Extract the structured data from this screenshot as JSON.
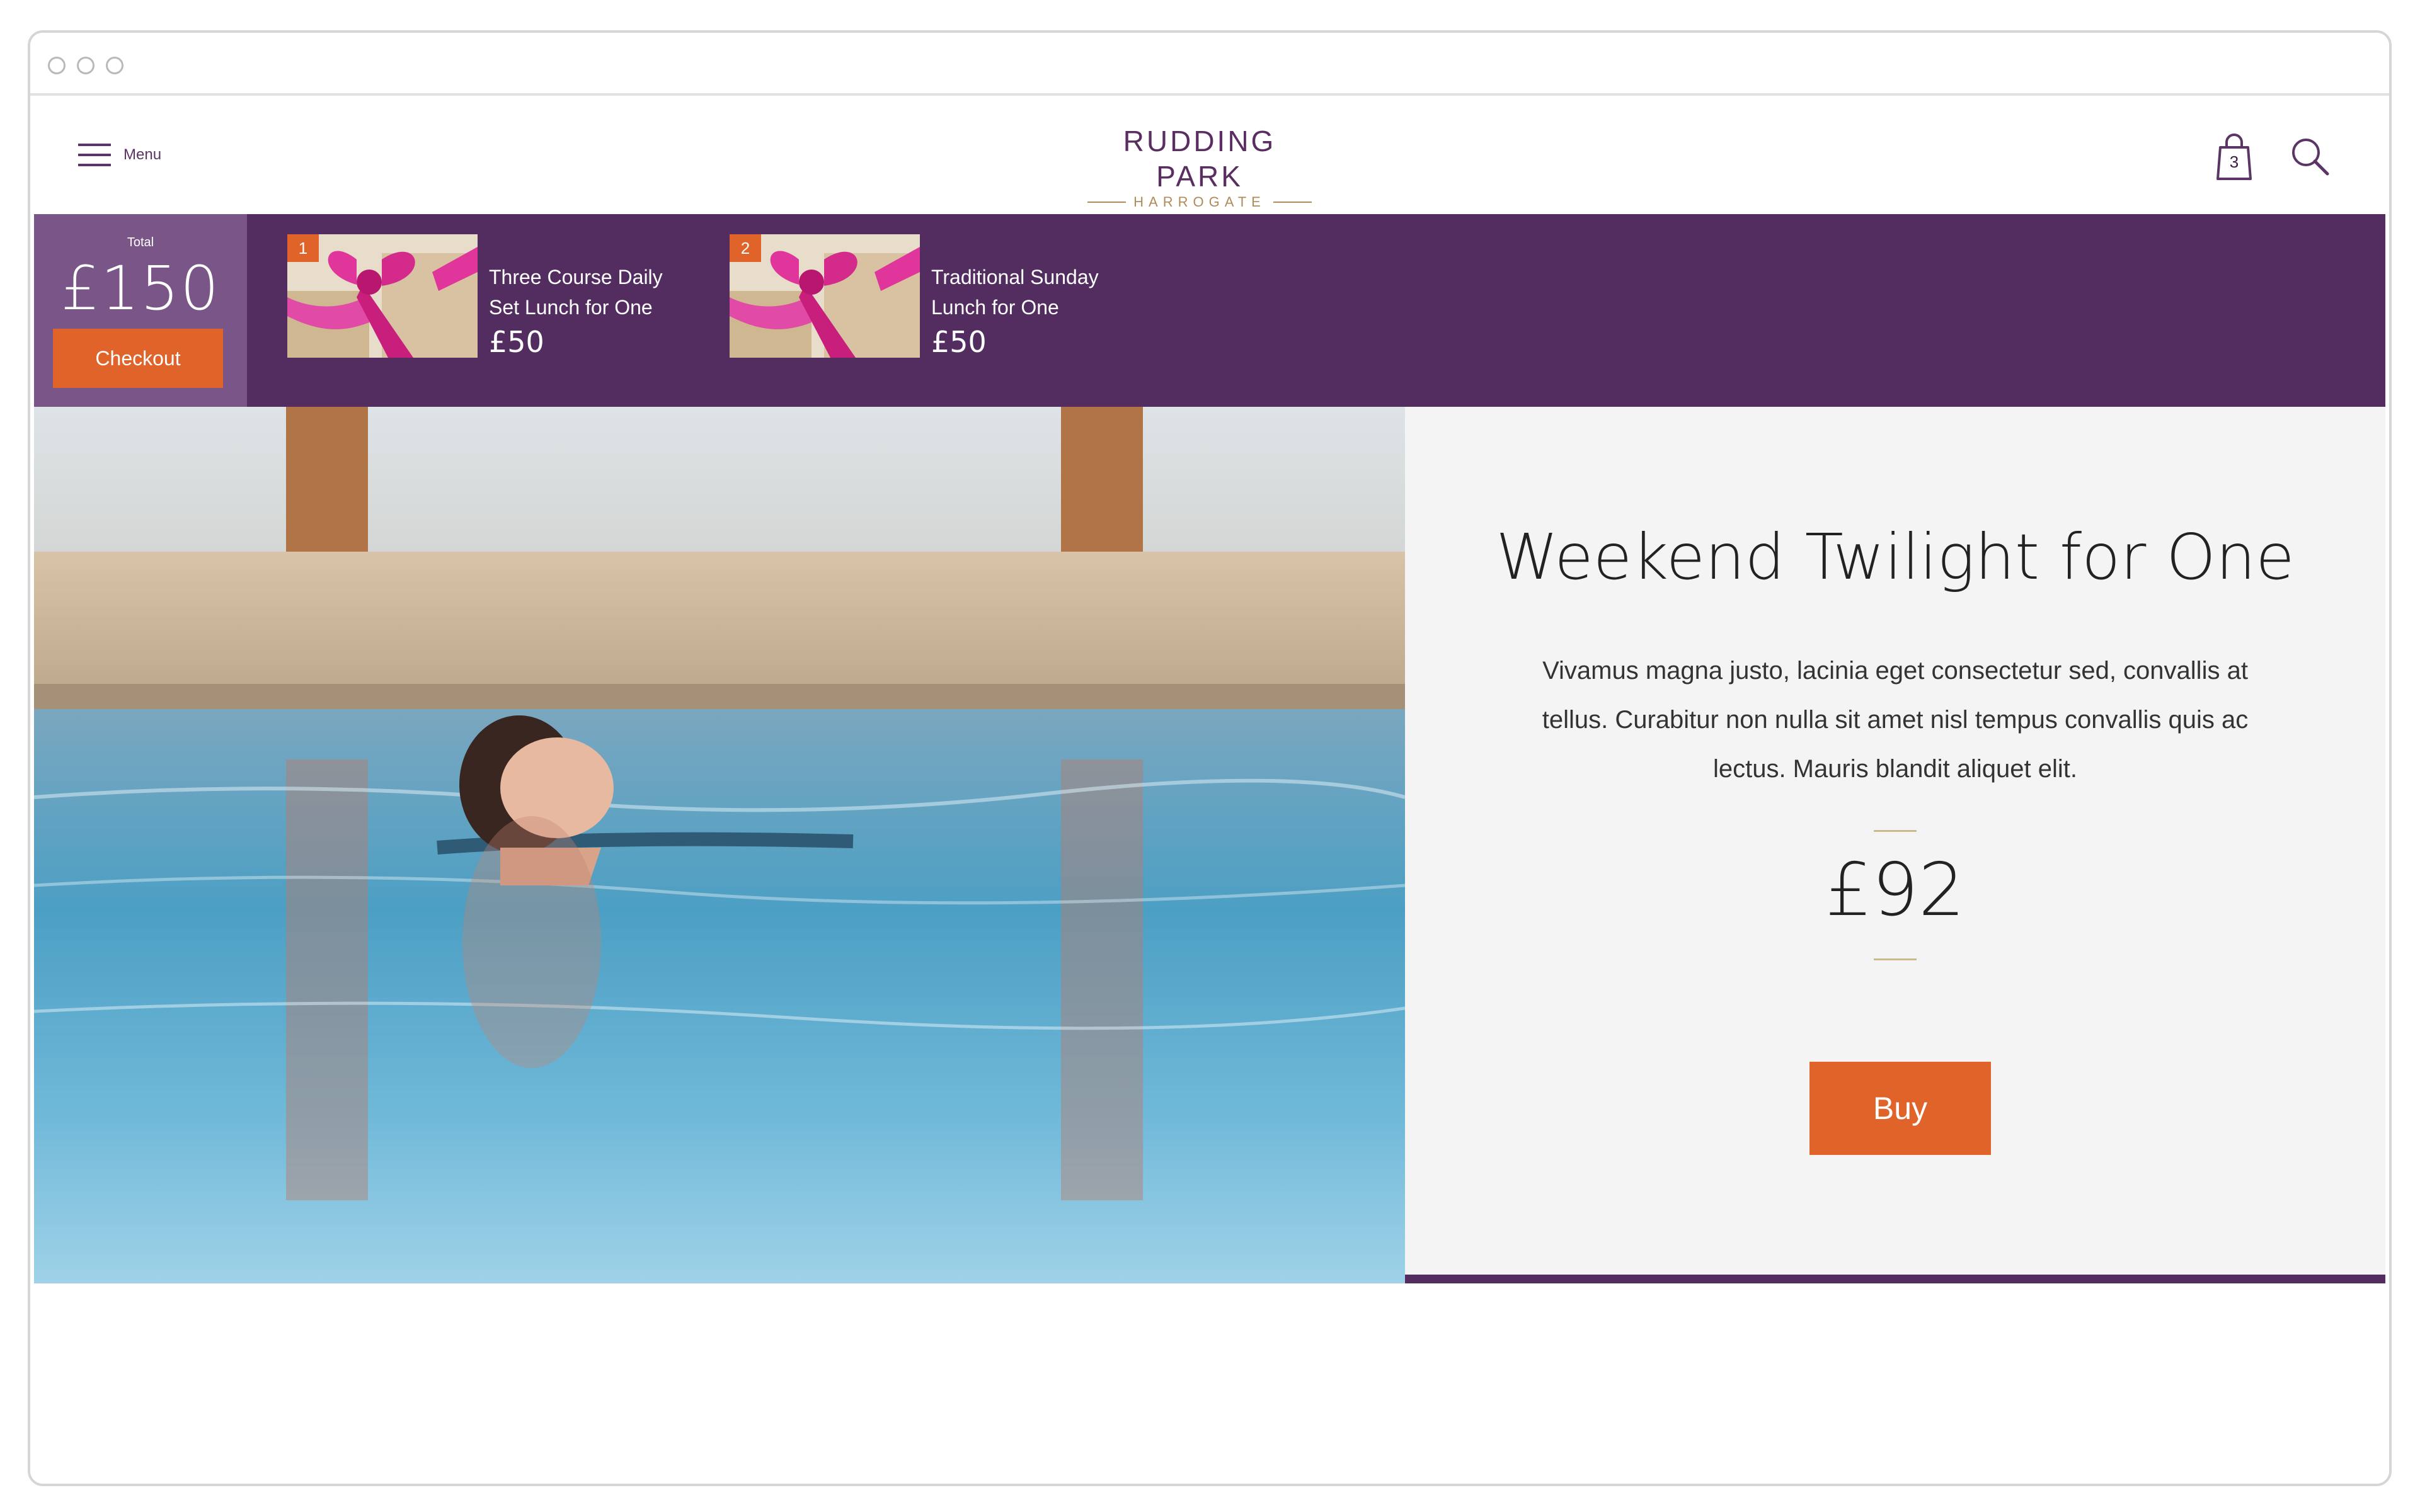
{
  "window": {
    "traffic_lights": [
      "close",
      "minimize",
      "maximize"
    ]
  },
  "header": {
    "menu_label": "Menu",
    "logo_main": "RUDDING PARK",
    "logo_sub": "HARROGATE",
    "cart_count": "3",
    "icons": [
      "hamburger-icon",
      "shopping-bag-icon",
      "search-icon"
    ]
  },
  "basket": {
    "total_label": "Total",
    "total_amount": "£150",
    "checkout_label": "Checkout",
    "items": [
      {
        "number": "1",
        "title_line1": "Three Course Daily",
        "title_line2": "Set Lunch for One",
        "price": "£50"
      },
      {
        "number": "2",
        "title_line1": "Traditional Sunday",
        "title_line2": "Lunch for One",
        "price": "£50"
      }
    ]
  },
  "product": {
    "title": "Weekend Twilight for One",
    "description": "Vivamus magna justo, lacinia eget consectetur sed, convallis at tellus. Curabitur non nulla sit amet nisl tempus convallis quis ac lectus. Mauris blandit aliquet elit.",
    "price": "£92",
    "buy_label": "Buy"
  },
  "colors": {
    "brand_purple": "#532d60",
    "total_panel": "#7a5587",
    "accent_orange": "#e0632a",
    "gold": "#b08a5a"
  }
}
